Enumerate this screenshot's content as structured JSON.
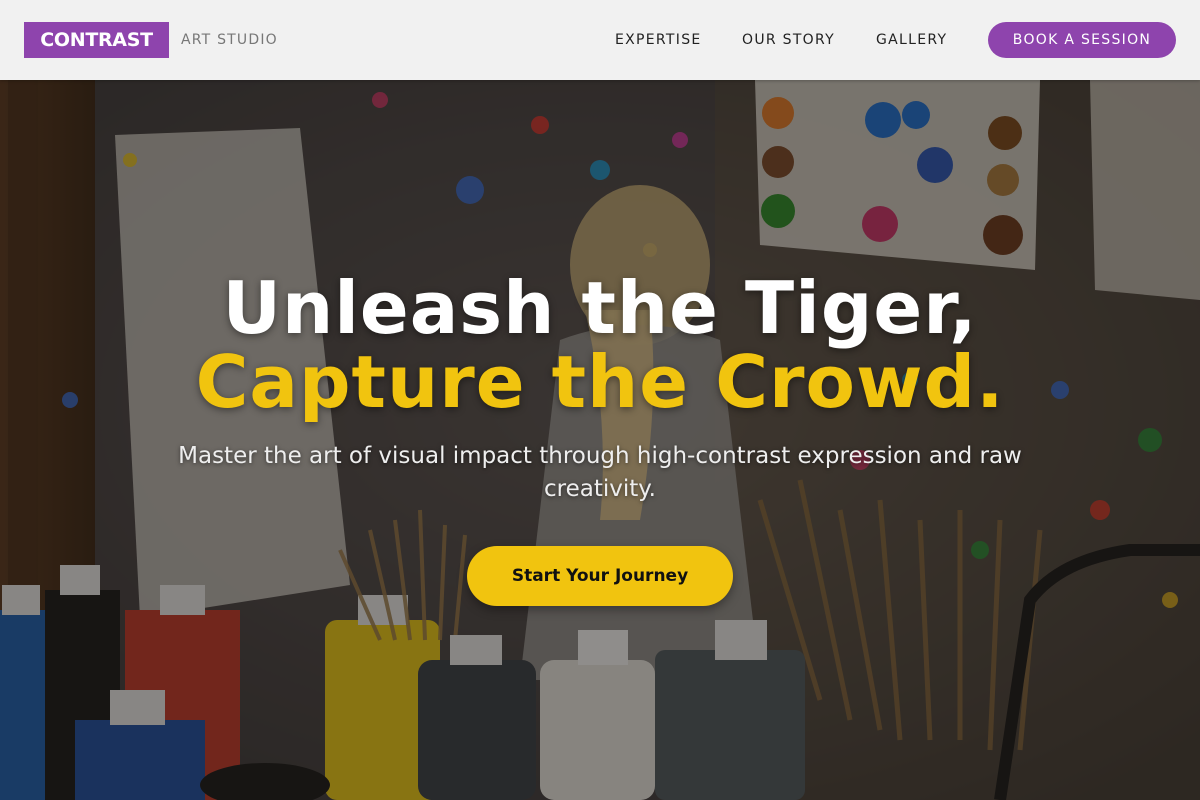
{
  "brand": {
    "name": "CONTRAST",
    "tagline": "ART STUDIO",
    "accent_color": "#8e44ad",
    "highlight_color": "#f1c40f"
  },
  "nav": {
    "items": [
      {
        "label": "EXPERTISE"
      },
      {
        "label": "OUR STORY"
      },
      {
        "label": "GALLERY"
      }
    ],
    "cta_label": "BOOK A SESSION"
  },
  "hero": {
    "headline_line1": "Unleash the Tiger,",
    "headline_line2": "Capture the Crowd.",
    "subtitle": "Master the art of visual impact through high-contrast expression and raw creativity.",
    "cta_label": "Start Your Journey",
    "background_image": "art-studio-paint-splatter-photo"
  }
}
